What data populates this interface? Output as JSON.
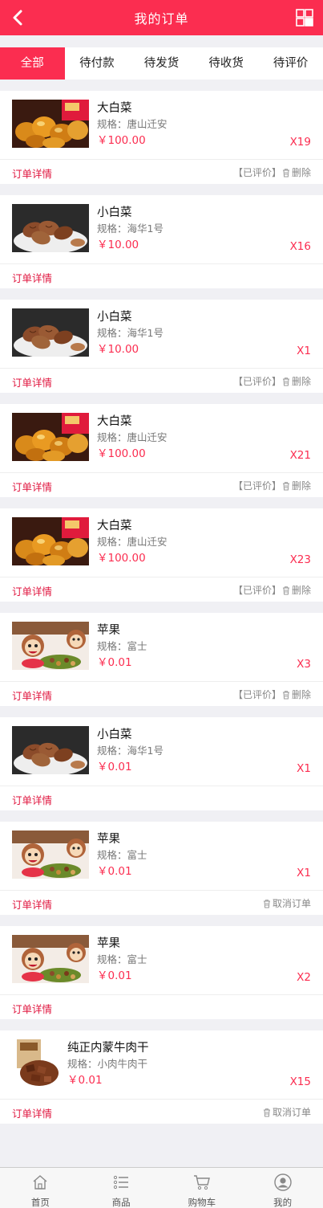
{
  "header": {
    "title": "我的订单"
  },
  "tabs": [
    {
      "label": "全部",
      "active": true
    },
    {
      "label": "待付款",
      "active": false
    },
    {
      "label": "待发货",
      "active": false
    },
    {
      "label": "待收货",
      "active": false
    },
    {
      "label": "待评价",
      "active": false
    }
  ],
  "detail_label": "订单详情",
  "orders": [
    {
      "image": "chestnut",
      "name": "大白菜",
      "spec": "规格：唐山迁安",
      "price": "￥100.00",
      "qty": "X19",
      "actions": [
        "【已评价】",
        "删除"
      ]
    },
    {
      "image": "pecan",
      "name": "小白菜",
      "spec": "规格：海华1号",
      "price": "￥10.00",
      "qty": "X16",
      "actions": []
    },
    {
      "image": "pecan",
      "name": "小白菜",
      "spec": "规格：海华1号",
      "price": "￥10.00",
      "qty": "X1",
      "actions": [
        "【已评价】",
        "删除"
      ]
    },
    {
      "image": "chestnut",
      "name": "大白菜",
      "spec": "规格：唐山迁安",
      "price": "￥100.00",
      "qty": "X21",
      "actions": [
        "【已评价】",
        "删除"
      ]
    },
    {
      "image": "chestnut",
      "name": "大白菜",
      "spec": "规格：唐山迁安",
      "price": "￥100.00",
      "qty": "X23",
      "actions": [
        "【已评价】",
        "删除"
      ]
    },
    {
      "image": "monkey",
      "name": "苹果",
      "spec": "规格：富士",
      "price": "￥0.01",
      "qty": "X3",
      "actions": [
        "【已评价】",
        "删除"
      ]
    },
    {
      "image": "pecan",
      "name": "小白菜",
      "spec": "规格：海华1号",
      "price": "￥0.01",
      "qty": "X1",
      "actions": []
    },
    {
      "image": "monkey",
      "name": "苹果",
      "spec": "规格：富士",
      "price": "￥0.01",
      "qty": "X1",
      "actions": [
        "取消订单"
      ]
    },
    {
      "image": "monkey",
      "name": "苹果",
      "spec": "规格：富士",
      "price": "￥0.01",
      "qty": "X2",
      "actions": []
    },
    {
      "image": "beef",
      "name": "纯正内蒙牛肉干",
      "spec": "规格：小肉牛肉干",
      "price": "￥0.01",
      "qty": "X15",
      "actions": [
        "取消订单"
      ]
    }
  ],
  "tabbar": [
    {
      "label": "首页",
      "icon": "home-icon"
    },
    {
      "label": "商品",
      "icon": "list-icon"
    },
    {
      "label": "购物车",
      "icon": "cart-icon"
    },
    {
      "label": "我的",
      "icon": "user-icon"
    }
  ],
  "colors": {
    "accent": "#fb2d50",
    "background": "#f0f0f4"
  }
}
